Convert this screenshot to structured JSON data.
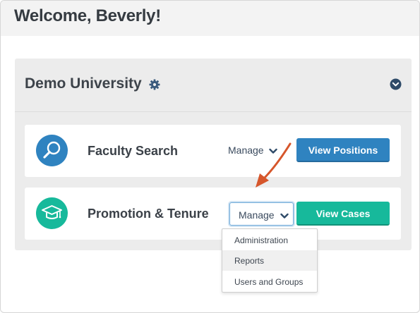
{
  "welcome": {
    "title": "Welcome, Beverly!"
  },
  "university": {
    "name": "Demo University",
    "settings_icon": "gear-icon",
    "collapse_icon": "chevron-circle-down-icon"
  },
  "apps": [
    {
      "title": "Faculty Search",
      "icon": "magnifier-icon",
      "icon_color": "#2f83c0",
      "manage_label": "Manage",
      "action_label": "View Positions",
      "action_color": "#2f83c0"
    },
    {
      "title": "Promotion & Tenure",
      "icon": "graduation-cap-icon",
      "icon_color": "#17b99b",
      "manage_label": "Manage",
      "action_label": "View Cases",
      "action_color": "#17b99b"
    }
  ],
  "manage_menu": {
    "items": [
      "Administration",
      "Reports",
      "Users and Groups"
    ],
    "highlighted": "Reports"
  },
  "annotation": {
    "arrow_color": "#d6562b"
  }
}
